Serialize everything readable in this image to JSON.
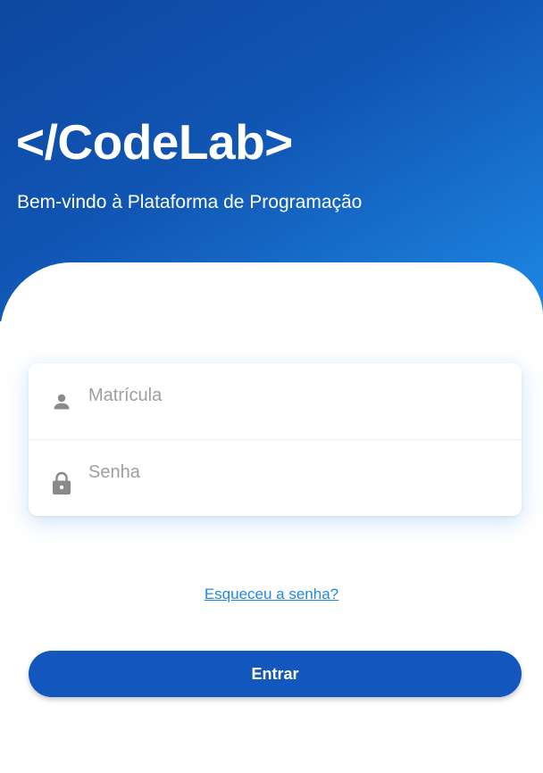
{
  "header": {
    "logo": "</CodeLab>",
    "subtitle": "Bem-vindo à Plataforma de Programação"
  },
  "form": {
    "matricula": {
      "placeholder": "Matrícula",
      "value": "",
      "icon": "person-icon"
    },
    "senha": {
      "placeholder": "Senha",
      "value": "",
      "icon": "lock-icon"
    }
  },
  "links": {
    "forgot_password": "Esqueceu a senha?"
  },
  "actions": {
    "enter_label": "Entrar"
  },
  "colors": {
    "primary": "#1256be",
    "gradient_start": "#0d47a1",
    "gradient_end": "#1e88e5",
    "link": "#1e88e5",
    "icon": "#8a8a8a",
    "placeholder": "#9e9e9e"
  }
}
